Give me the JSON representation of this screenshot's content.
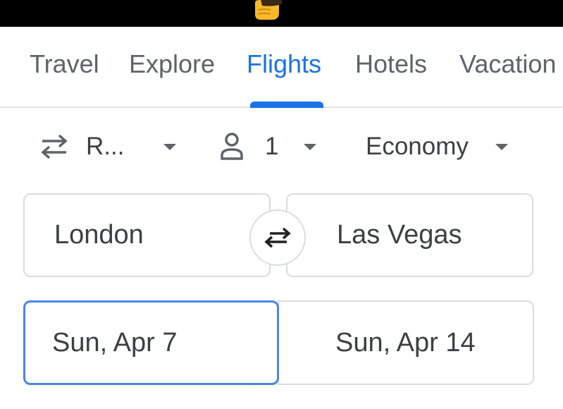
{
  "nav": {
    "tabs": [
      {
        "label": "Travel",
        "active": false
      },
      {
        "label": "Explore",
        "active": false
      },
      {
        "label": "Flights",
        "active": true
      },
      {
        "label": "Hotels",
        "active": false
      },
      {
        "label": "Vacation",
        "active": false
      }
    ],
    "active_color": "#1a73e8"
  },
  "search_options": {
    "trip_type": {
      "label": "R...",
      "icon": "round-trip-arrows-icon"
    },
    "passengers": {
      "label": "1",
      "icon": "person-icon"
    },
    "cabin_class": {
      "label": "Economy"
    }
  },
  "route": {
    "origin": "London",
    "destination": "Las Vegas",
    "swap_icon": "swap-arrows-icon"
  },
  "dates": {
    "departure": "Sun, Apr 7",
    "return": "Sun, Apr 14"
  },
  "colors": {
    "accent": "#1a73e8",
    "focused_border": "#4a86e8",
    "topbar": "#000000"
  }
}
